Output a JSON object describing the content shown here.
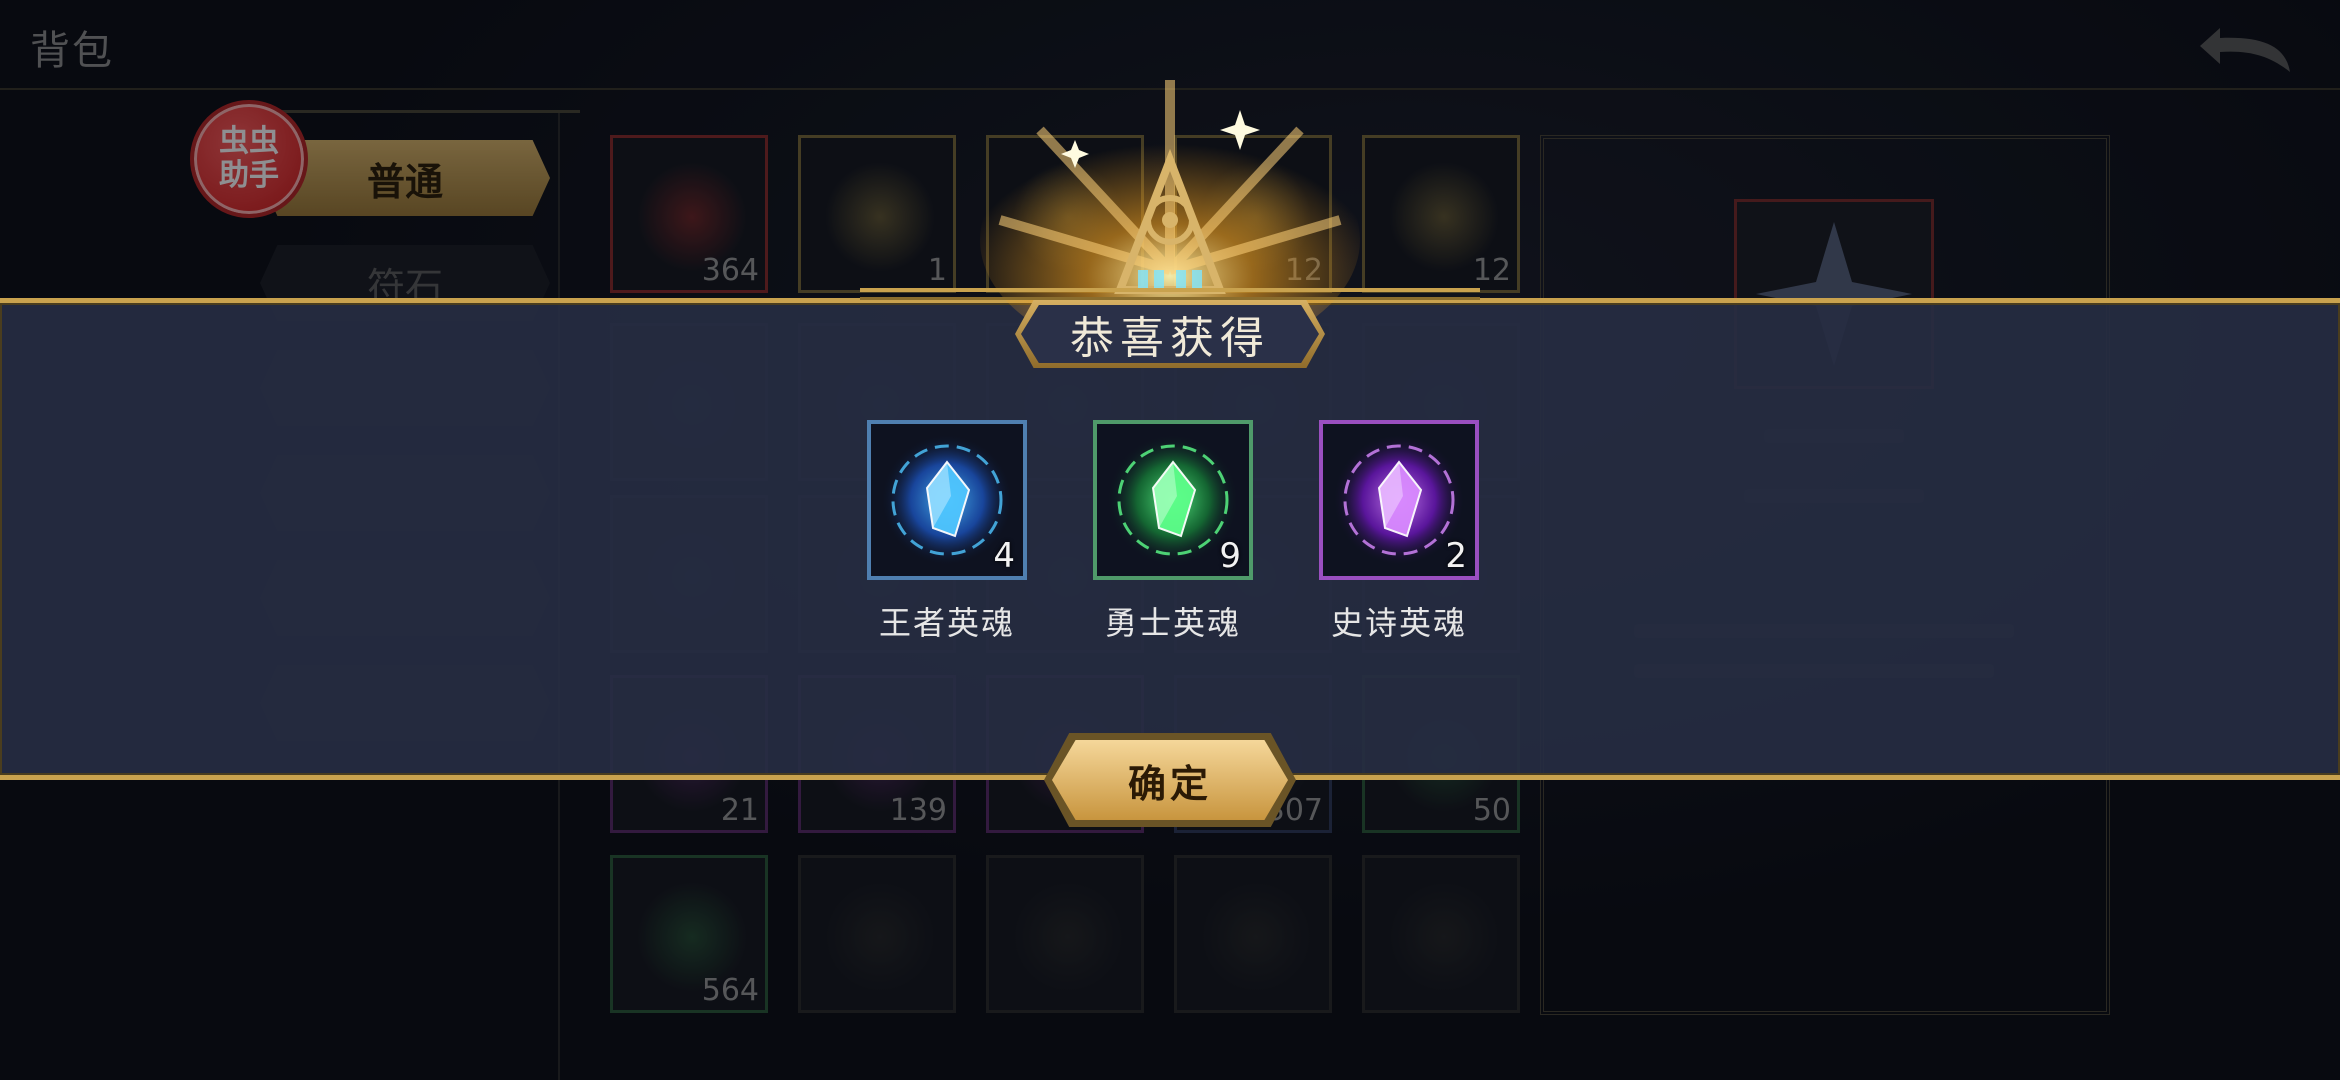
{
  "header": {
    "title": "背包",
    "back_icon": "back-arrow-icon"
  },
  "helper_badge": {
    "label": "虫虫助手"
  },
  "menu": {
    "items": [
      {
        "label": "普通",
        "active": true
      },
      {
        "label": "符石",
        "active": false
      },
      {
        "label": "",
        "active": false
      },
      {
        "label": "",
        "active": false
      },
      {
        "label": "",
        "active": false
      },
      {
        "label": "",
        "active": false
      }
    ]
  },
  "grid": {
    "rows": [
      [
        {
          "count": "364",
          "color": "#8a2a2a"
        },
        {
          "count": "1",
          "color": "#7a6a3a"
        },
        {
          "count": "",
          "color": "#7a6a3a"
        },
        {
          "count": "12",
          "color": "#7a6a3a"
        },
        {
          "count": "12",
          "color": "#7a6a3a"
        }
      ],
      [
        {
          "count": "",
          "color": "#2e3a4a"
        },
        {
          "count": "",
          "color": "#2e3a4a"
        },
        {
          "count": "",
          "color": "#2e3a4a"
        },
        {
          "count": "",
          "color": "#2e3a4a"
        },
        {
          "count": "",
          "color": "#2e3a4a"
        }
      ],
      [
        {
          "count": "",
          "color": "#2e3a4a"
        },
        {
          "count": "",
          "color": "#2e3a4a"
        },
        {
          "count": "",
          "color": "#2e3a4a"
        },
        {
          "count": "",
          "color": "#2e3a4a"
        },
        {
          "count": "",
          "color": "#2e3a4a"
        }
      ],
      [
        {
          "count": "21",
          "color": "#5a2a6a"
        },
        {
          "count": "139",
          "color": "#5a2a6a"
        },
        {
          "count": "",
          "color": "#5a2a6a"
        },
        {
          "count": "307",
          "color": "#2e3a5a"
        },
        {
          "count": "50",
          "color": "#2a5a3a"
        }
      ],
      [
        {
          "count": "564",
          "color": "#2a5a3a"
        },
        {
          "count": "",
          "color": "#2a2a2a"
        },
        {
          "count": "",
          "color": "#2a2a2a"
        },
        {
          "count": "",
          "color": "#2a2a2a"
        },
        {
          "count": "",
          "color": "#2a2a2a"
        }
      ]
    ]
  },
  "reward_popup": {
    "title": "恭喜获得",
    "confirm_label": "确定",
    "items": [
      {
        "name": "王者英魂",
        "count": "4",
        "border": "#4f7fb0",
        "gem": "#4fc6ff",
        "glow": "#1d5bd0"
      },
      {
        "name": "勇士英魂",
        "count": "9",
        "border": "#4f9a6a",
        "gem": "#5dff8a",
        "glow": "#178a3a"
      },
      {
        "name": "史诗英魂",
        "count": "2",
        "border": "#9a4fc0",
        "gem": "#d98aff",
        "glow": "#7a17d0"
      }
    ]
  },
  "colors": {
    "gold": "#c9a24e",
    "banner": "#262d42"
  }
}
